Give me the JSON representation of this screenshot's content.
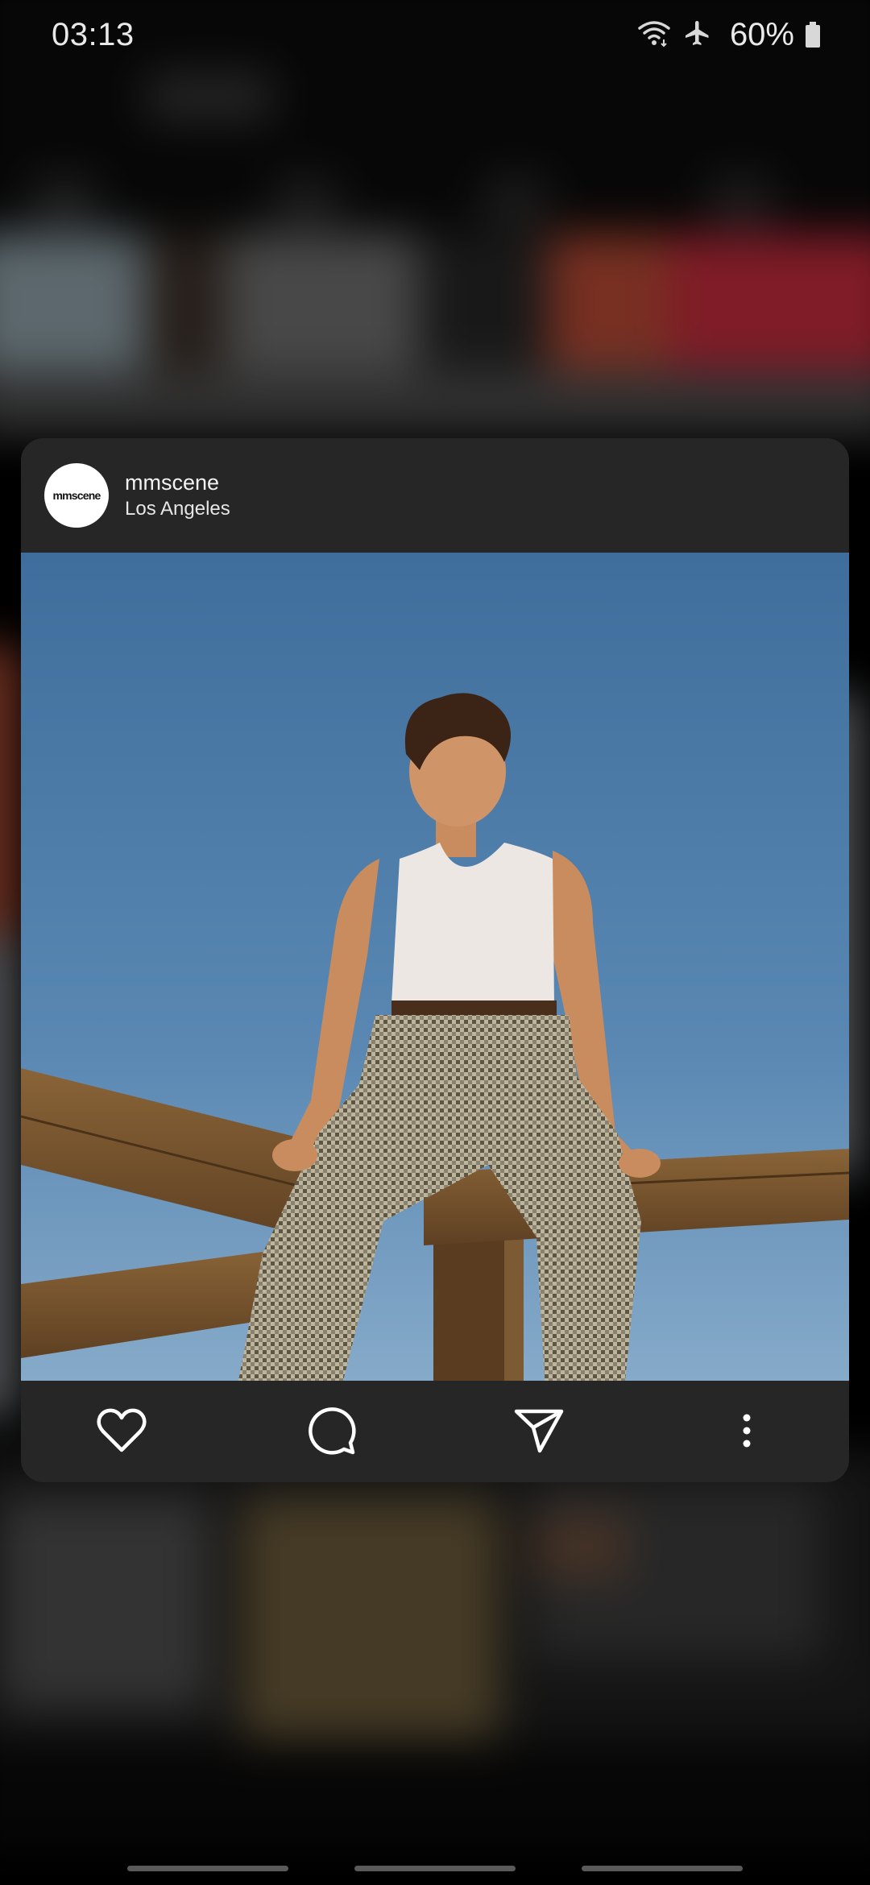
{
  "status_bar": {
    "time": "03:13",
    "battery_percent": "60%",
    "icons": [
      "wifi-icon",
      "airplane-mode-icon",
      "battery-icon"
    ],
    "battery_level": 0.6
  },
  "post_preview": {
    "username": "mmscene",
    "location": "Los Angeles",
    "avatar_text": "mmscene",
    "photo_description_icon": "post-photo",
    "actions": [
      {
        "name": "like-button",
        "icon": "heart-icon"
      },
      {
        "name": "comment-button",
        "icon": "comment-icon"
      },
      {
        "name": "share-button",
        "icon": "send-icon"
      },
      {
        "name": "more-options-button",
        "icon": "more-vertical-icon"
      }
    ]
  },
  "colors": {
    "card_background": "#262626",
    "sky": "#5b89b4",
    "screen_background": "#000000"
  }
}
